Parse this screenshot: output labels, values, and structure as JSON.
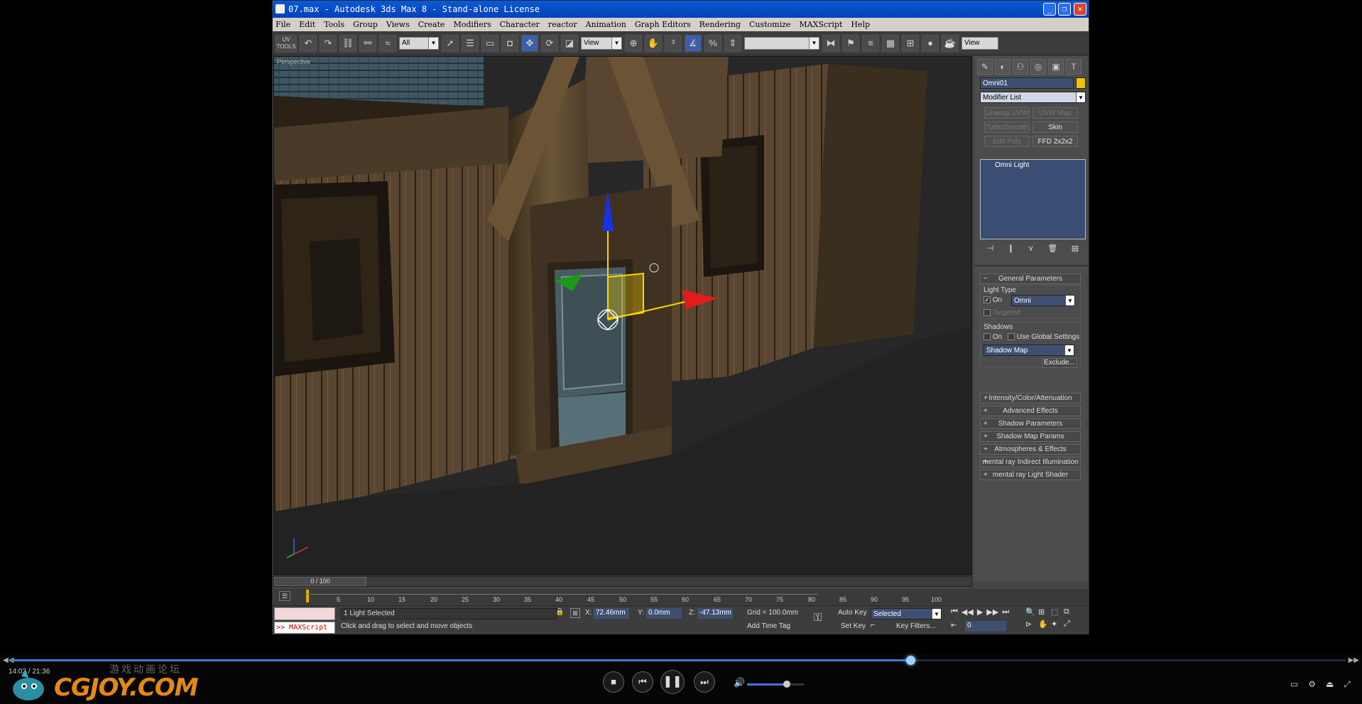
{
  "window": {
    "title": "07.max - Autodesk 3ds Max 8  - Stand-alone License"
  },
  "menu": [
    "File",
    "Edit",
    "Tools",
    "Group",
    "Views",
    "Create",
    "Modifiers",
    "Character",
    "reactor",
    "Animation",
    "Graph Editors",
    "Rendering",
    "Customize",
    "MAXScript",
    "Help"
  ],
  "toolbar": {
    "uv_label": "UV\nTOOLS",
    "filter_value": "All",
    "refcoord_value": "View",
    "refcoord2_value": "View"
  },
  "viewport": {
    "label": "Perspective"
  },
  "command_panel": {
    "object_name": "Omni01",
    "object_color": "#f0c400",
    "modifier_list": "Modifier List",
    "modifier_buttons": [
      {
        "label": "Unwrap UVW",
        "enabled": false
      },
      {
        "label": "UVW Map",
        "enabled": false
      },
      {
        "label": "TurboSmooth",
        "enabled": false
      },
      {
        "label": "Skin",
        "enabled": true
      },
      {
        "label": "Edit Poly",
        "enabled": false
      },
      {
        "label": "FFD 2x2x2",
        "enabled": true
      }
    ],
    "stack_item": "Omni Light",
    "general_params": "General Parameters",
    "light_type": {
      "group": "Light Type",
      "on_label": "On",
      "on_checked": true,
      "type_value": "Omni",
      "targeted_label": "Targeted"
    },
    "shadows": {
      "group": "Shadows",
      "on_label": "On",
      "global_label": "Use Global Settings",
      "type_value": "Shadow Map",
      "exclude_label": "Exclude..."
    },
    "rollouts": [
      "Intensity/Color/Attenuation",
      "Advanced Effects",
      "Shadow Parameters",
      "Shadow Map Params",
      "Atmospheres & Effects",
      "mental ray Indirect Illumination",
      "mental ray Light Shader"
    ]
  },
  "timeline": {
    "frame_text": "0 / 100",
    "ticks": [
      "5",
      "10",
      "15",
      "20",
      "25",
      "30",
      "35",
      "40",
      "45",
      "50",
      "55",
      "60",
      "65",
      "70",
      "75",
      "80",
      "85",
      "90",
      "95",
      "100"
    ]
  },
  "status": {
    "maxscript_label": ">> MAXScript",
    "selection": "1 Light Selected",
    "prompt": "Click and drag to select and move objects",
    "x_label": "X:",
    "x_value": "72.46mm",
    "y_label": "Y:",
    "y_value": "0.0mm",
    "z_label": "Z:",
    "z_value": "-47.13mm",
    "grid": "Grid = 100.0mm",
    "add_time_tag": "Add Time Tag",
    "auto_key": "Auto Key",
    "selected_value": "Selected",
    "set_key": "Set Key",
    "key_filters": "Key Filters...",
    "frame_value": "0"
  },
  "player": {
    "time": "14:03 / 21:36",
    "progress": 0.674,
    "volume": 0.7,
    "watermark_cn": "游戏动画论坛",
    "watermark": "CGJOY.COM"
  }
}
